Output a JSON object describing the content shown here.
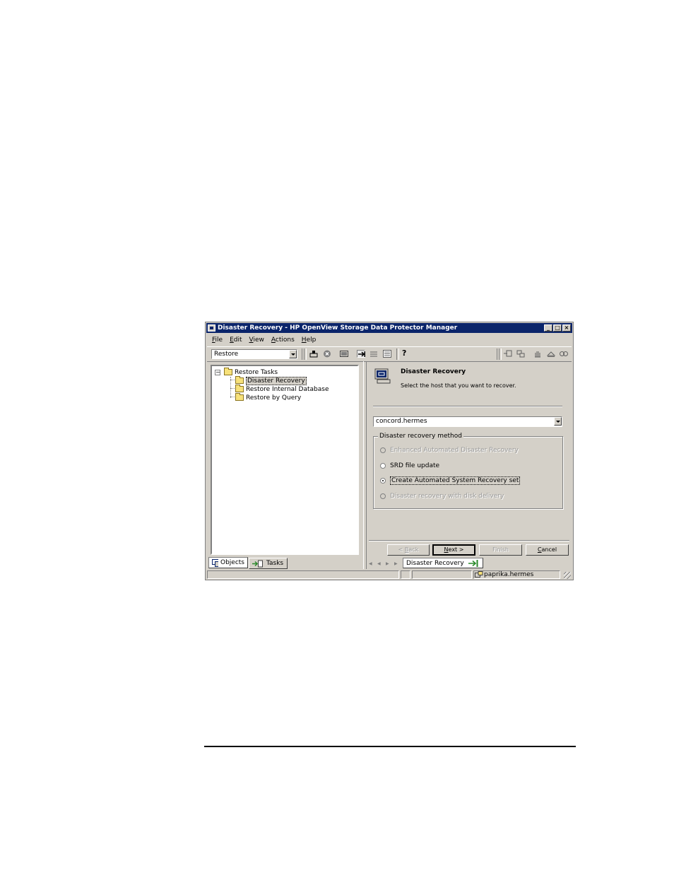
{
  "window": {
    "title": "Disaster Recovery - HP OpenView Storage Data Protector Manager",
    "minimize": "_",
    "maximize": "□",
    "close": "×"
  },
  "menu": {
    "items": [
      {
        "hot": "F",
        "rest": "ile"
      },
      {
        "hot": "E",
        "rest": "dit"
      },
      {
        "hot": "V",
        "rest": "iew"
      },
      {
        "hot": "A",
        "rest": "ctions"
      },
      {
        "hot": "H",
        "rest": "elp"
      }
    ]
  },
  "toolbar": {
    "context": "Restore",
    "help_glyph": "?"
  },
  "tree": {
    "root": "Restore Tasks",
    "children": [
      "Disaster Recovery",
      "Restore Internal Database",
      "Restore by Query"
    ],
    "expander": "−"
  },
  "left_tabs": {
    "objects": "Objects",
    "tasks": "Tasks"
  },
  "wizard": {
    "title": "Disaster Recovery",
    "subtitle": "Select the host that you want to recover.",
    "host": "concord.hermes",
    "group_label": "Disaster recovery method",
    "options": [
      {
        "label": "Enhanced Automated Disaster Recovery",
        "enabled": false,
        "selected": false
      },
      {
        "label": "SRD file update",
        "enabled": true,
        "selected": false
      },
      {
        "label": "Create Automated System Recovery set",
        "enabled": true,
        "selected": true
      },
      {
        "label": "Disaster recovery with disk delivery",
        "enabled": false,
        "selected": false
      }
    ],
    "buttons": {
      "back_pre": "< ",
      "back_hot": "B",
      "back_post": "ack",
      "next_hot": "N",
      "next_post": "ext >",
      "finish": "Finish",
      "cancel_hot": "C",
      "cancel_post": "ancel"
    }
  },
  "right_tab": {
    "label": "Disaster Recovery"
  },
  "status": {
    "host": "paprika.hermes"
  },
  "colors": {
    "titlebar": "#0a246a",
    "face": "#d4d0c8"
  }
}
